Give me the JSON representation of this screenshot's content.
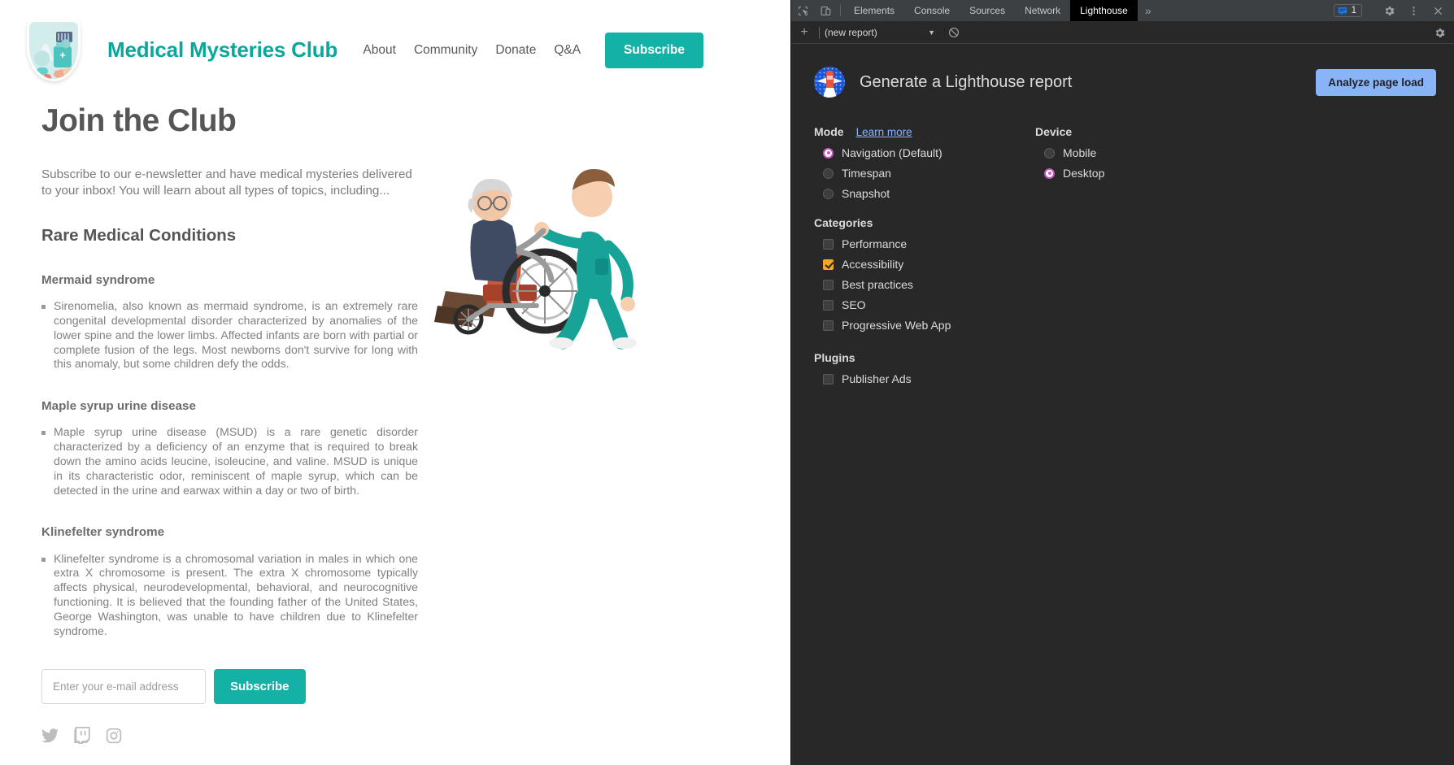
{
  "site": {
    "brand_title": "Medical Mysteries Club",
    "logo_icon": "medical-shield-logo",
    "nav": [
      {
        "label": "About"
      },
      {
        "label": "Community"
      },
      {
        "label": "Donate"
      },
      {
        "label": "Q&A"
      }
    ],
    "subscribe_button": "Subscribe",
    "page_title": "Join the Club",
    "intro": "Subscribe to our e-newsletter and have medical mysteries delivered to your inbox! You will learn about all types of topics, including...",
    "section_title": "Rare Medical Conditions",
    "conditions": [
      {
        "name": "Mermaid syndrome",
        "description": "Sirenomelia, also known as mermaid syndrome, is an extremely rare congenital developmental disorder characterized by anomalies of the lower spine and the lower limbs. Affected infants are born with partial or complete fusion of the legs. Most newborns don't survive for long with this anomaly, but some children defy the odds."
      },
      {
        "name": "Maple syrup urine disease",
        "description": "Maple syrup urine disease (MSUD) is a rare genetic disorder characterized by a deficiency of an enzyme that is required to break down the amino acids leucine, isoleucine, and valine. MSUD is unique in its characteristic odor, reminiscent of maple syrup, which can be detected in the urine and earwax within a day or two of birth."
      },
      {
        "name": "Klinefelter syndrome",
        "description": "Klinefelter syndrome is a chromosomal variation in males in which one extra X chromosome is present. The extra X chromosome typically affects physical, neurodevelopmental, behavioral, and neurocognitive functioning. It is believed that the founding father of the United States, George Washington, was unable to have children due to Klinefelter syndrome."
      }
    ],
    "signup": {
      "email_placeholder": "Enter your e-mail address",
      "email_value": "",
      "submit_label": "Subscribe"
    },
    "social": [
      {
        "icon": "twitter-icon",
        "label": "Twitter"
      },
      {
        "icon": "twitch-icon",
        "label": "Twitch"
      },
      {
        "icon": "instagram-icon",
        "label": "Instagram"
      }
    ],
    "illustration_alt": "nurse-pushing-patient-in-wheelchair-illustration",
    "colors": {
      "brand_teal": "#0aa89c",
      "button_teal": "#14b2a6",
      "text_gray": "#7b7b7b"
    }
  },
  "devtools": {
    "toolbar": {
      "inspect_icon": "inspect-element-icon",
      "device_toggle_icon": "device-toolbar-icon",
      "tabs": [
        {
          "label": "Elements",
          "active": false
        },
        {
          "label": "Console",
          "active": false
        },
        {
          "label": "Sources",
          "active": false
        },
        {
          "label": "Network",
          "active": false
        },
        {
          "label": "Lighthouse",
          "active": true
        }
      ],
      "more_tabs_label": "»",
      "issues_count": "1",
      "issues_icon": "issues-counter-icon",
      "settings_icon": "gear-icon",
      "menu_icon": "more-vertical-icon",
      "close_icon": "close-icon"
    },
    "subbar": {
      "add_icon": "plus-icon",
      "report_select_value": "(new report)",
      "caret_icon": "chevron-down-icon",
      "clear_icon": "clear-report-icon",
      "settings_icon": "gear-icon"
    },
    "lighthouse": {
      "logo_icon": "lighthouse-logo-icon",
      "heading": "Generate a Lighthouse report",
      "analyze_button": "Analyze page load",
      "mode": {
        "title": "Mode",
        "learn_more": "Learn more",
        "options": [
          {
            "label": "Navigation (Default)",
            "selected": true
          },
          {
            "label": "Timespan",
            "selected": false
          },
          {
            "label": "Snapshot",
            "selected": false
          }
        ]
      },
      "device": {
        "title": "Device",
        "options": [
          {
            "label": "Mobile",
            "selected": false
          },
          {
            "label": "Desktop",
            "selected": true
          }
        ]
      },
      "categories": {
        "title": "Categories",
        "options": [
          {
            "label": "Performance",
            "checked": false
          },
          {
            "label": "Accessibility",
            "checked": true
          },
          {
            "label": "Best practices",
            "checked": false
          },
          {
            "label": "SEO",
            "checked": false
          },
          {
            "label": "Progressive Web App",
            "checked": false
          }
        ]
      },
      "plugins": {
        "title": "Plugins",
        "options": [
          {
            "label": "Publisher Ads",
            "checked": false
          }
        ]
      },
      "colors": {
        "accent_radio": "#c558c0",
        "accent_checkbox": "#f5a623",
        "link": "#8ab4f8"
      }
    }
  }
}
